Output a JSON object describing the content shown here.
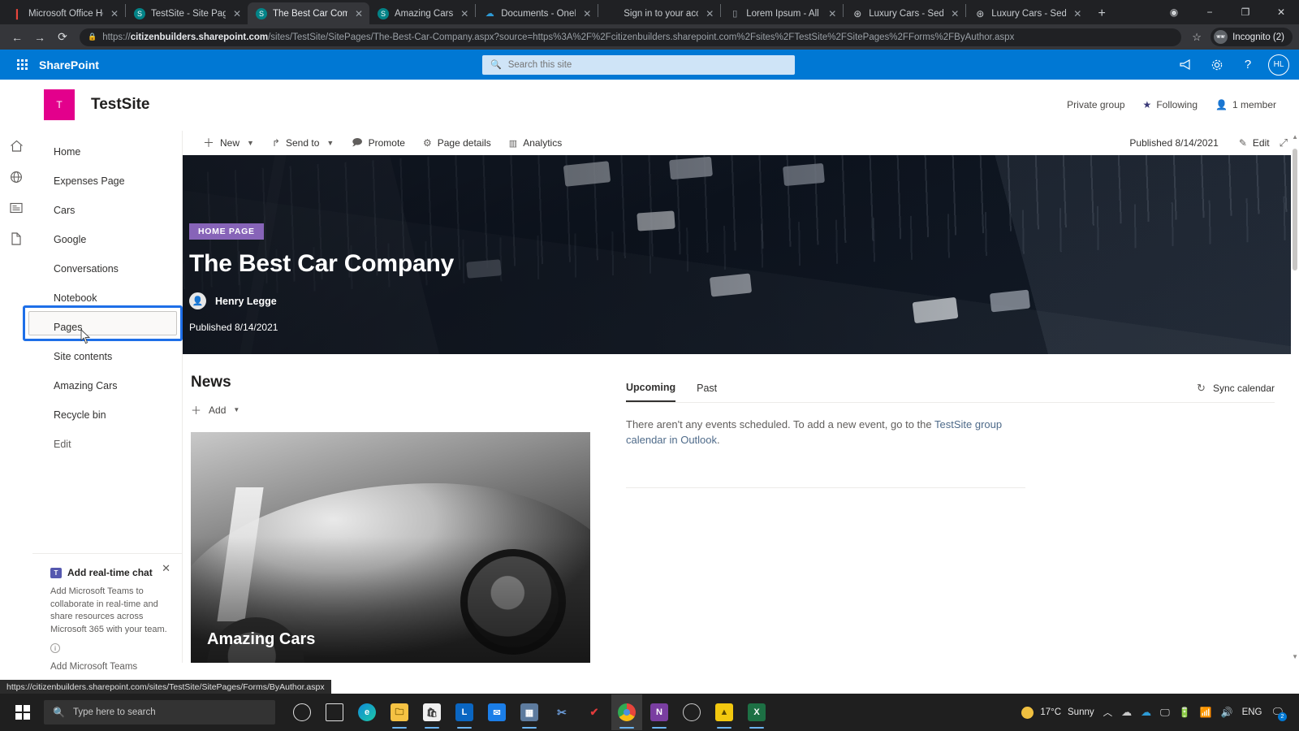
{
  "browser": {
    "tabs": [
      {
        "title": "Microsoft Office Home",
        "favicon": "office-icon",
        "active": false
      },
      {
        "title": "TestSite - Site Pages -",
        "favicon": "sharepoint-icon",
        "active": false
      },
      {
        "title": "The Best Car Company",
        "favicon": "sharepoint-icon",
        "active": true
      },
      {
        "title": "Amazing Cars",
        "favicon": "sharepoint-icon",
        "active": false
      },
      {
        "title": "Documents - OneDrive",
        "favicon": "onedrive-icon",
        "active": false
      },
      {
        "title": "Sign in to your account",
        "favicon": "microsoft-icon",
        "active": false
      },
      {
        "title": "Lorem Ipsum - All the",
        "favicon": "generic-icon",
        "active": false
      },
      {
        "title": "Luxury Cars - Sedans,",
        "favicon": "mercedes-icon",
        "active": false
      },
      {
        "title": "Luxury Cars - Sedans,",
        "favicon": "mercedes-icon",
        "active": false
      }
    ],
    "new_tab_label": "+",
    "close_label": "✕",
    "window_controls": {
      "minimize": "−",
      "maximize": "❐",
      "close": "✕",
      "extension": "◉"
    },
    "nav": {
      "back": "←",
      "forward": "→",
      "reload": "⟳"
    },
    "url_prefix": "https://",
    "url_domain": "citizenbuilders.sharepoint.com",
    "url_path": "/sites/TestSite/SitePages/The-Best-Car-Company.aspx?source=https%3A%2F%2Fcitizenbuilders.sharepoint.com%2Fsites%2FTestSite%2FSitePages%2FForms%2FByAuthor.aspx",
    "lock_icon": "lock-icon",
    "star_icon": "star-icon",
    "profile_label": "Incognito (2)",
    "status_url": "https://citizenbuilders.sharepoint.com/sites/TestSite/SitePages/Forms/ByAuthor.aspx"
  },
  "suitebar": {
    "waffle": "app-launcher-icon",
    "brand": "SharePoint",
    "search_placeholder": "Search this site",
    "search_icon": "search-icon",
    "icons": [
      {
        "name": "megaphone-icon",
        "glyph": "📣"
      },
      {
        "name": "gear-icon",
        "glyph": "⚙"
      },
      {
        "name": "help-icon",
        "glyph": "?"
      }
    ],
    "avatar_initials": "HL"
  },
  "site_header": {
    "logo_letter": "T",
    "logo_color": "#e3008c",
    "title": "TestSite",
    "privacy": "Private group",
    "following": "Following",
    "following_icon": "star-icon",
    "members": "1 member",
    "members_icon": "person-icon"
  },
  "left_rail": {
    "icons": [
      {
        "name": "home-icon",
        "glyph": "⌂"
      },
      {
        "name": "globe-icon",
        "glyph": "🌐"
      },
      {
        "name": "news-feed-icon",
        "glyph": "▤"
      },
      {
        "name": "files-icon",
        "glyph": "🗋"
      }
    ]
  },
  "sidenav": {
    "items": [
      {
        "label": "Home"
      },
      {
        "label": "Expenses Page"
      },
      {
        "label": "Cars"
      },
      {
        "label": "Google"
      },
      {
        "label": "Conversations"
      },
      {
        "label": "Notebook"
      },
      {
        "label": "Pages",
        "highlighted": true
      },
      {
        "label": "Site contents"
      },
      {
        "label": "Amazing Cars"
      },
      {
        "label": "Recycle bin"
      },
      {
        "label": "Edit",
        "muted": true
      }
    ],
    "highlight_color": "#1e6fe8"
  },
  "teams_promo": {
    "close_icon": "close-icon",
    "teams_icon": "teams-icon",
    "heading": "Add real-time chat",
    "body": "Add Microsoft Teams to collaborate in real-time and share resources across Microsoft 365 with your team.",
    "info_icon": "info-icon",
    "link": "Add Microsoft Teams"
  },
  "command_bar": {
    "items": [
      {
        "label": "New",
        "icon": "plus-icon",
        "chevron": true
      },
      {
        "label": "Send to",
        "icon": "share-icon",
        "chevron": true
      },
      {
        "label": "Promote",
        "icon": "promote-icon",
        "chevron": false
      },
      {
        "label": "Page details",
        "icon": "gear-icon",
        "chevron": false
      },
      {
        "label": "Analytics",
        "icon": "analytics-icon",
        "chevron": false
      }
    ],
    "published": "Published 8/14/2021",
    "edit_label": "Edit",
    "edit_icon": "pencil-icon",
    "expand_icon": "expand-icon"
  },
  "hero": {
    "badge": "HOME PAGE",
    "badge_color": "#8764b8",
    "title": "The Best Car Company",
    "author": "Henry Legge",
    "author_avatar_icon": "person-avatar-icon",
    "published": "Published 8/14/2021"
  },
  "news": {
    "heading": "News",
    "add_label": "Add",
    "add_icon": "plus-icon",
    "add_chevron": "chevron-down-icon",
    "card_title": "Amazing Cars"
  },
  "events": {
    "tabs": [
      {
        "label": "Upcoming",
        "active": true
      },
      {
        "label": "Past",
        "active": false
      }
    ],
    "sync_label": "Sync calendar",
    "sync_icon": "refresh-icon",
    "empty_text_before": "There aren't any events scheduled. To add a new event, go to the ",
    "empty_link": "TestSite group calendar in Outlook",
    "empty_text_after": "."
  },
  "taskbar": {
    "start_icon": "windows-icon",
    "search_placeholder": "Type here to search",
    "search_icon": "search-icon",
    "apps": [
      {
        "name": "cortana-icon",
        "glyph": "○",
        "color": "transparent",
        "open": false
      },
      {
        "name": "task-view-icon",
        "glyph": "▯",
        "color": "transparent",
        "open": false
      },
      {
        "name": "edge-icon",
        "glyph": "e",
        "color": "#0e79c4",
        "open": false
      },
      {
        "name": "file-explorer-icon",
        "glyph": "🗀",
        "color": "#f5c243",
        "open": true
      },
      {
        "name": "store-icon",
        "glyph": "🛍",
        "color": "#e8e8e8",
        "open": true
      },
      {
        "name": "linkedin-icon",
        "glyph": "L",
        "color": "#0a66c2",
        "open": true
      },
      {
        "name": "mail-icon",
        "glyph": "✉",
        "color": "#1b7ee8",
        "open": false
      },
      {
        "name": "calculator-icon",
        "glyph": "▦",
        "color": "#5d7b9e",
        "open": true
      },
      {
        "name": "snip-tool-icon",
        "glyph": "✂",
        "color": "#3f6fa8",
        "open": false
      },
      {
        "name": "todo-icon",
        "glyph": "15",
        "color": "#e03b3b",
        "open": false
      },
      {
        "name": "chrome-icon",
        "glyph": "◉",
        "color": "#e8453c",
        "open": true,
        "active": true
      },
      {
        "name": "onenote-icon",
        "glyph": "N",
        "color": "#7a3ea1",
        "open": true
      },
      {
        "name": "teams-icon",
        "glyph": "⊗",
        "color": "#5558af",
        "open": false
      },
      {
        "name": "power-bi-icon",
        "glyph": "▲",
        "color": "#f2c80f",
        "open": true
      },
      {
        "name": "excel-icon",
        "glyph": "X",
        "color": "#1d7044",
        "open": true
      }
    ],
    "tray": {
      "weather_temp": "17°C",
      "weather_desc": "Sunny",
      "weather_icon": "sun-icon",
      "chevron_icon": "chevron-up-icon",
      "onedrive_gray_icon": "cloud-icon",
      "onedrive_blue_icon": "onedrive-icon",
      "screen_icon": "display-icon",
      "battery_icon": "battery-icon",
      "wifi_icon": "wifi-icon",
      "volume_icon": "speaker-icon",
      "language": "ENG",
      "notification_icon": "notification-icon",
      "notification_count": "2"
    }
  }
}
